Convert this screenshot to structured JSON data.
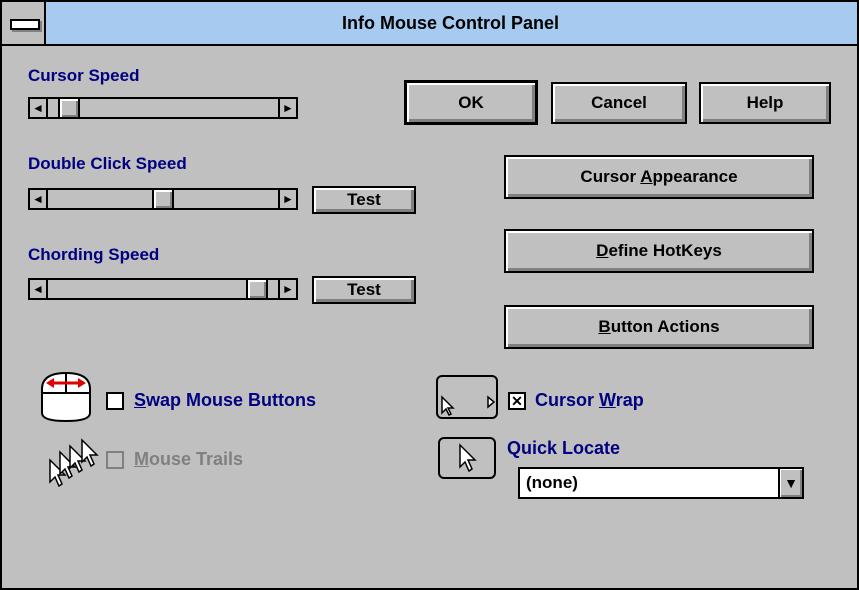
{
  "window": {
    "title": "Info Mouse Control Panel"
  },
  "cursor_speed": {
    "label": "Cursor Speed",
    "level": 0.05
  },
  "double_click_speed": {
    "label": "Double Click Speed",
    "level": 0.5,
    "test_label": "Test"
  },
  "chording_speed": {
    "label": "Chording Speed",
    "level": 0.95,
    "test_label": "Test"
  },
  "buttons": {
    "ok": "OK",
    "cancel": "Cancel",
    "help": "Help",
    "cursor_appearance": {
      "before": "Cursor ",
      "underline": "A",
      "after": "ppearance"
    },
    "define_hotkeys": {
      "before": "",
      "underline": "D",
      "after": "efine HotKeys"
    },
    "button_actions": {
      "before": "",
      "underline": "B",
      "after": "utton Actions"
    }
  },
  "options": {
    "swap_mouse_buttons": {
      "underline": "S",
      "after": "wap Mouse Buttons",
      "checked": false
    },
    "mouse_trails": {
      "underline": "M",
      "after": "ouse Trails",
      "checked": false,
      "enabled": false
    },
    "cursor_wrap": {
      "before": "Cursor ",
      "underline": "W",
      "after": "rap",
      "checked": true
    }
  },
  "quick_locate": {
    "label": "Quick Locate",
    "value": "(none)"
  },
  "glyphs": {
    "left": "◄",
    "right": "►",
    "down": "▼",
    "check": "✕"
  },
  "colors": {
    "title_bar": "#a6caf0",
    "label_text": "#000080",
    "face": "#c0c0c0"
  }
}
